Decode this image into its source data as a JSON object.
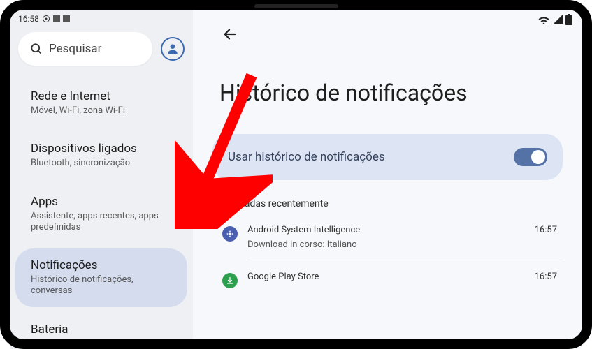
{
  "status": {
    "time": "16:58"
  },
  "search": {
    "placeholder": "Pesquisar"
  },
  "sidebar": {
    "items": [
      {
        "title": "Rede e Internet",
        "sub": "Móvel, Wi-Fi, zona Wi-Fi"
      },
      {
        "title": "Dispositivos ligados",
        "sub": "Bluetooth, sincronização"
      },
      {
        "title": "Apps",
        "sub": "Assistente, apps recentes, apps predefinidas"
      },
      {
        "title": "Notificações",
        "sub": "Histórico de notificações, conversas"
      },
      {
        "title": "Bateria",
        "sub": ""
      }
    ]
  },
  "page": {
    "title": "Histórico de notificações",
    "toggleLabel": "Usar histórico de notificações",
    "sectionHeader": "Ignoradas recentemente",
    "notifications": [
      {
        "app": "Android System Intelligence",
        "text": "Download in corso: Italiano",
        "time": "16:57"
      },
      {
        "app": "Google Play Store",
        "text": "",
        "time": "16:57"
      }
    ]
  }
}
